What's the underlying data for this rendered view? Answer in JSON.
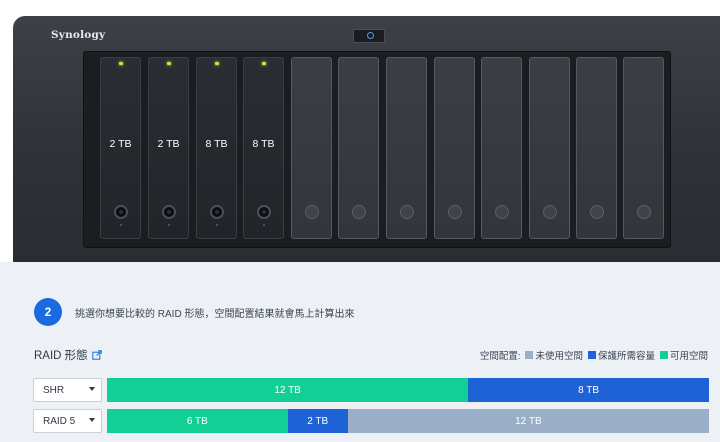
{
  "device": {
    "brand": "Synology",
    "bays": [
      {
        "filled": true,
        "capacity": "2 TB"
      },
      {
        "filled": true,
        "capacity": "2 TB"
      },
      {
        "filled": true,
        "capacity": "8 TB"
      },
      {
        "filled": true,
        "capacity": "8 TB"
      },
      {
        "filled": false,
        "capacity": ""
      },
      {
        "filled": false,
        "capacity": ""
      },
      {
        "filled": false,
        "capacity": ""
      },
      {
        "filled": false,
        "capacity": ""
      },
      {
        "filled": false,
        "capacity": ""
      },
      {
        "filled": false,
        "capacity": ""
      },
      {
        "filled": false,
        "capacity": ""
      },
      {
        "filled": false,
        "capacity": ""
      }
    ]
  },
  "step": {
    "number": "2",
    "text": "挑選你想要比較的 RAID 形態，空間配置結果就會馬上計算出來"
  },
  "raid_section": {
    "title": "RAID 形態",
    "legend_label": "空間配置:",
    "legend": [
      {
        "label": "未使用空間",
        "color": "#9aafc7"
      },
      {
        "label": "保護所需容量",
        "color": "#1e63d6"
      },
      {
        "label": "可用空間",
        "color": "#12cf96"
      }
    ]
  },
  "colors": {
    "available": "#12cf96",
    "protection": "#1e63d6",
    "unused": "#9aafc7",
    "accent": "#1a6be0"
  },
  "rows": [
    {
      "raid_type": "SHR",
      "segments": [
        {
          "kind": "available",
          "label": "12 TB",
          "tb": 12
        },
        {
          "kind": "protection",
          "label": "8 TB",
          "tb": 8
        }
      ]
    },
    {
      "raid_type": "RAID 5",
      "segments": [
        {
          "kind": "available",
          "label": "6 TB",
          "tb": 6
        },
        {
          "kind": "protection",
          "label": "2 TB",
          "tb": 2
        },
        {
          "kind": "unused",
          "label": "12 TB",
          "tb": 12
        }
      ]
    }
  ]
}
